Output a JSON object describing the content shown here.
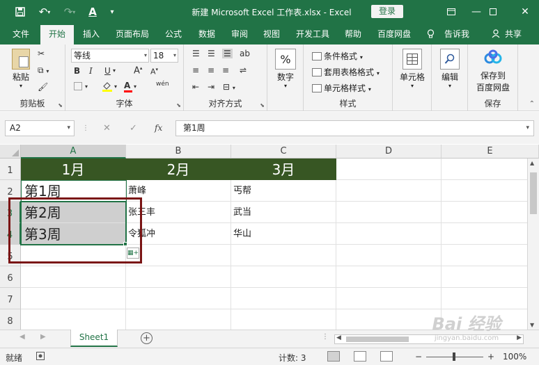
{
  "app": {
    "title": "新建 Microsoft Excel 工作表.xlsx  -  Excel",
    "login": "登录",
    "brand_color": "#217346"
  },
  "quick_access": [
    "save-icon",
    "undo-icon",
    "redo-icon",
    "font-color-icon",
    "customize-icon"
  ],
  "window_controls": [
    "ribbon-options-icon",
    "minimize-icon",
    "maximize-icon",
    "close-icon"
  ],
  "tabs": {
    "items": [
      "文件",
      "开始",
      "插入",
      "页面布局",
      "公式",
      "数据",
      "审阅",
      "视图",
      "开发工具",
      "帮助",
      "百度网盘"
    ],
    "active": "开始",
    "tell_me": "告诉我",
    "share": "共享"
  },
  "ribbon": {
    "clipboard": {
      "paste": "粘贴",
      "label": "剪贴板"
    },
    "font": {
      "name": "等线",
      "size": "18",
      "bold": "B",
      "italic": "I",
      "underline": "U",
      "grow": "A",
      "shrink": "A",
      "font_color": "A",
      "phonetic": "wén",
      "label": "字体"
    },
    "alignment": {
      "label": "对齐方式"
    },
    "number": {
      "button": "数字",
      "symbol": "%"
    },
    "styles": {
      "conditional": "条件格式",
      "table": "套用表格格式",
      "cell": "单元格样式",
      "label": "样式"
    },
    "cells": {
      "button": "单元格"
    },
    "editing": {
      "button": "编辑"
    },
    "save": {
      "button_line1": "保存到",
      "button_line2": "百度网盘",
      "label": "保存"
    }
  },
  "formula_bar": {
    "name_box": "A2",
    "formula": "第1周",
    "fx": "fx"
  },
  "grid": {
    "columns": [
      "A",
      "B",
      "C",
      "D",
      "E"
    ],
    "selected_column": "A",
    "rows": [
      "1",
      "2",
      "3",
      "4",
      "5",
      "6",
      "7",
      "8"
    ],
    "selected_rows": [
      "3",
      "4"
    ],
    "header_fill": "#375623",
    "cells": {
      "A1": "1月",
      "B1": "2月",
      "C1": "3月",
      "A2": "第1周",
      "B2": "萧峰",
      "C2": "丐帮",
      "A3": "第2周",
      "B3": "张三丰",
      "C3": "武当",
      "A4": "第3周",
      "B4": "令狐冲",
      "C4": "华山"
    }
  },
  "sheets": {
    "items": [
      "Sheet1"
    ],
    "active": "Sheet1"
  },
  "status_bar": {
    "ready": "就绪",
    "count": "计数: 3",
    "zoom": "100%"
  },
  "watermark": {
    "text": "Bai 经验",
    "url": "jingyan.baidu.com"
  }
}
